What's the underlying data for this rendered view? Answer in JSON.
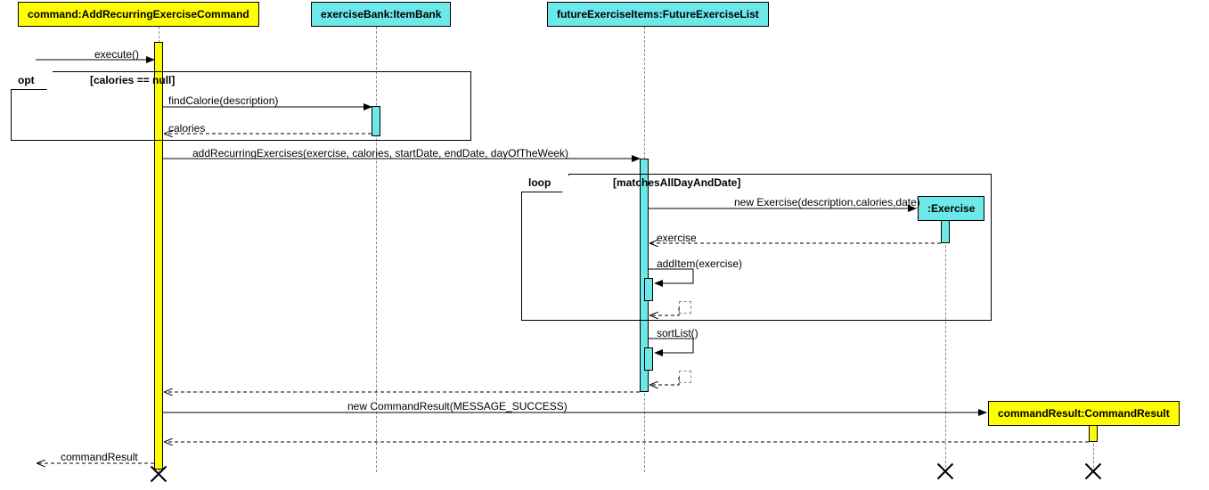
{
  "participants": {
    "command": "command:AddRecurringExerciseCommand",
    "exerciseBank": "exerciseBank:ItemBank",
    "futureExerciseItems": "futureExerciseItems:FutureExerciseList",
    "exercise": ":Exercise",
    "commandResult": "commandResult:CommandResult"
  },
  "frames": {
    "opt": {
      "label": "opt",
      "guard": "[calories == null]"
    },
    "loop": {
      "label": "loop",
      "guard": "[matchesAllDayAndDate]"
    }
  },
  "messages": {
    "execute": "execute()",
    "findCalorie": "findCalorie(description)",
    "caloriesReturn": "calories",
    "addRecurring": "addRecurringExercises(exercise, calories, startDate, endDate, dayOfTheWeek)",
    "newExercise": "new Exercise(description,calories,date)",
    "exerciseReturn": "exercise",
    "addItem": "addItem(exercise)",
    "sortList": "sortList()",
    "newCommandResult": "new CommandResult(MESSAGE_SUCCESS)",
    "commandResultReturn": "commandResult"
  },
  "chart_data": {
    "type": "uml-sequence-diagram",
    "participants": [
      {
        "id": "command",
        "label": "command:AddRecurringExerciseCommand",
        "stereotype": "class",
        "color": "yellow"
      },
      {
        "id": "exerciseBank",
        "label": "exerciseBank:ItemBank",
        "stereotype": "class",
        "color": "cyan"
      },
      {
        "id": "futureExerciseItems",
        "label": "futureExerciseItems:FutureExerciseList",
        "stereotype": "class",
        "color": "cyan"
      },
      {
        "id": "exercise",
        "label": ":Exercise",
        "stereotype": "class",
        "color": "cyan",
        "created": true
      },
      {
        "id": "commandResult",
        "label": "commandResult:CommandResult",
        "stereotype": "class",
        "color": "yellow",
        "created": true
      }
    ],
    "interactions": [
      {
        "type": "message",
        "from": "(external)",
        "to": "command",
        "label": "execute()",
        "kind": "sync"
      },
      {
        "type": "frame",
        "kind": "opt",
        "guard": "calories == null",
        "contains": [
          {
            "type": "message",
            "from": "command",
            "to": "exerciseBank",
            "label": "findCalorie(description)",
            "kind": "sync"
          },
          {
            "type": "return",
            "from": "exerciseBank",
            "to": "command",
            "label": "calories"
          }
        ]
      },
      {
        "type": "message",
        "from": "command",
        "to": "futureExerciseItems",
        "label": "addRecurringExercises(exercise, calories, startDate, endDate, dayOfTheWeek)",
        "kind": "sync"
      },
      {
        "type": "frame",
        "kind": "loop",
        "guard": "matchesAllDayAndDate",
        "contains": [
          {
            "type": "create",
            "from": "futureExerciseItems",
            "to": "exercise",
            "label": "new Exercise(description,calories,date)"
          },
          {
            "type": "return",
            "from": "exercise",
            "to": "futureExerciseItems",
            "label": "exercise"
          },
          {
            "type": "message",
            "from": "futureExerciseItems",
            "to": "futureExerciseItems",
            "label": "addItem(exercise)",
            "kind": "self"
          },
          {
            "type": "return",
            "from": "futureExerciseItems",
            "to": "futureExerciseItems"
          }
        ]
      },
      {
        "type": "message",
        "from": "futureExerciseItems",
        "to": "futureExerciseItems",
        "label": "sortList()",
        "kind": "self"
      },
      {
        "type": "return",
        "from": "futureExerciseItems",
        "to": "futureExerciseItems"
      },
      {
        "type": "return",
        "from": "futureExerciseItems",
        "to": "command"
      },
      {
        "type": "create",
        "from": "command",
        "to": "commandResult",
        "label": "new CommandResult(MESSAGE_SUCCESS)"
      },
      {
        "type": "return",
        "from": "commandResult",
        "to": "command"
      },
      {
        "type": "return",
        "from": "command",
        "to": "(external)",
        "label": "commandResult"
      },
      {
        "type": "destroy",
        "target": "exercise"
      },
      {
        "type": "destroy",
        "target": "commandResult"
      },
      {
        "type": "destroy",
        "target": "command"
      }
    ]
  }
}
